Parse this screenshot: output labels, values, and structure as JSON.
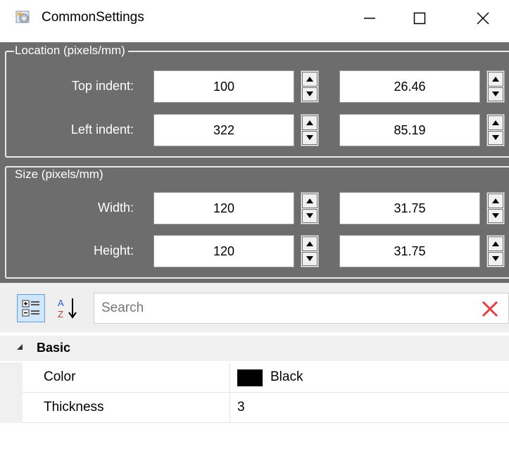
{
  "window": {
    "title": "CommonSettings",
    "minimize_glyph": "—",
    "maximize_glyph": "☐",
    "close_glyph": "✕"
  },
  "location": {
    "legend": "Location (pixels/mm)",
    "top_indent": {
      "label": "Top indent:",
      "pixels": "100",
      "mm": "26.46"
    },
    "left_indent": {
      "label": "Left indent:",
      "pixels": "322",
      "mm": "85.19"
    }
  },
  "size": {
    "legend": "Size (pixels/mm)",
    "width": {
      "label": "Width:",
      "pixels": "120",
      "mm": "31.75"
    },
    "height": {
      "label": "Height:",
      "pixels": "120",
      "mm": "31.75"
    }
  },
  "property_grid": {
    "search_placeholder": "Search",
    "category": "Basic",
    "properties": [
      {
        "name": "Color",
        "value": "Black",
        "swatch_color": "#000000"
      },
      {
        "name": "Thickness",
        "value": "3"
      }
    ]
  },
  "colors": {
    "panel_bg": "#6d6d6d",
    "group_border": "#e8e8e8",
    "clear_icon": "#e04040"
  }
}
